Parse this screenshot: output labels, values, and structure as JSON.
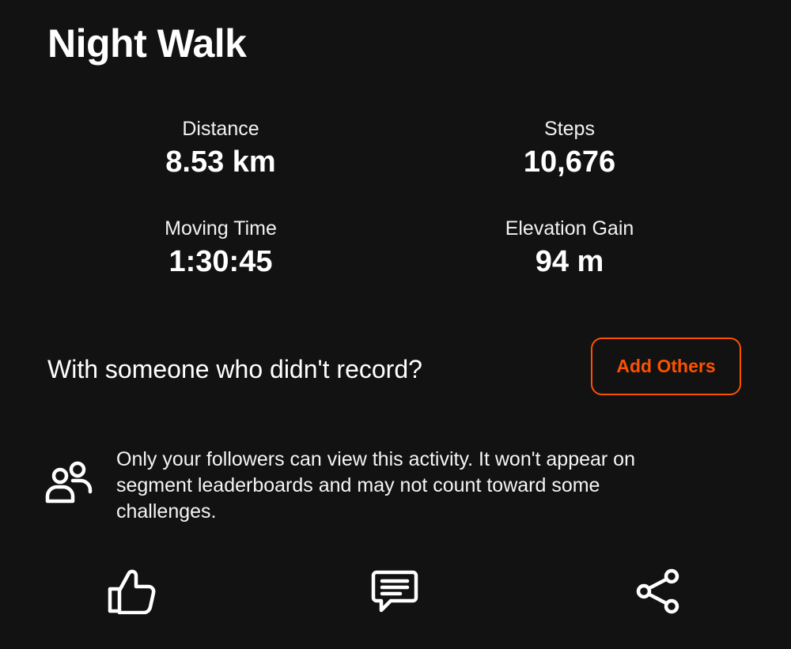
{
  "activity": {
    "title": "Night Walk"
  },
  "stats": {
    "distance": {
      "label": "Distance",
      "value": "8.53 km"
    },
    "steps": {
      "label": "Steps",
      "value": "10,676"
    },
    "moving_time": {
      "label": "Moving Time",
      "value": "1:30:45"
    },
    "elevation_gain": {
      "label": "Elevation Gain",
      "value": "94 m"
    }
  },
  "add_others": {
    "prompt": "With someone who didn't record?",
    "button_label": "Add Others"
  },
  "privacy": {
    "icon": "followers-icon",
    "text": "Only your followers can view this activity. It won't appear on segment leaderboards and may not count toward some challenges."
  },
  "actions": {
    "like_icon": "thumbs-up-icon",
    "comment_icon": "comment-icon",
    "share_icon": "share-icon"
  },
  "colors": {
    "background": "#121212",
    "accent": "#fc5200",
    "text": "#ffffff"
  }
}
